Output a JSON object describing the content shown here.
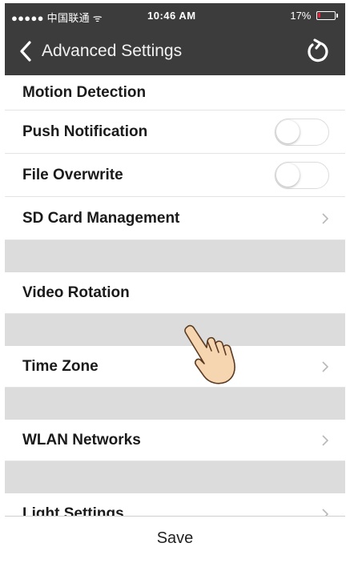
{
  "status_bar": {
    "carrier": "●●●●● 中国联通 ᯤ",
    "time": "10:46 AM",
    "battery_percent": "17%",
    "battery_level": 0.17,
    "battery_color": "#e8213a"
  },
  "nav": {
    "back_icon": "chevron-left-icon",
    "title": "Advanced Settings",
    "refresh_icon": "refresh-icon"
  },
  "settings": {
    "motion_detection": {
      "label": "Motion Detection"
    },
    "push_notification": {
      "label": "Push Notification",
      "toggle_on": false
    },
    "file_overwrite": {
      "label": "File Overwrite",
      "toggle_on": false
    },
    "sd_card": {
      "label": "SD Card Management"
    },
    "video_rotation": {
      "label": "Video Rotation"
    },
    "time_zone": {
      "label": "Time Zone"
    },
    "wlan": {
      "label": "WLAN Networks"
    },
    "light": {
      "label": "Light Settings"
    }
  },
  "save": {
    "label": "Save"
  },
  "colors": {
    "header_bg": "#3c3c3c",
    "section_gap": "#dcdcdc"
  }
}
